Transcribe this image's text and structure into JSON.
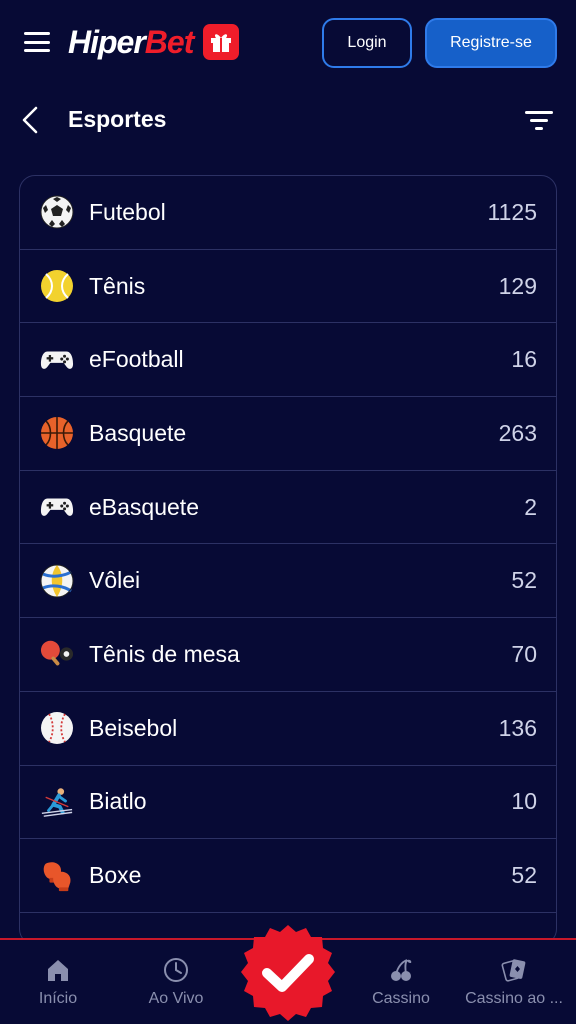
{
  "header": {
    "logo_hiper": "Hiper",
    "logo_bet": "Bet",
    "login_label": "Login",
    "register_label": "Registre-se"
  },
  "section": {
    "title": "Esportes"
  },
  "sports": [
    {
      "name": "Futebol",
      "count": "1125",
      "icon": "soccer-ball-icon"
    },
    {
      "name": "Tênis",
      "count": "129",
      "icon": "tennis-ball-icon"
    },
    {
      "name": "eFootball",
      "count": "16",
      "icon": "gamepad-icon"
    },
    {
      "name": "Basquete",
      "count": "263",
      "icon": "basketball-icon"
    },
    {
      "name": "eBasquete",
      "count": "2",
      "icon": "gamepad-icon"
    },
    {
      "name": "Vôlei",
      "count": "52",
      "icon": "volleyball-icon"
    },
    {
      "name": "Tênis de mesa",
      "count": "70",
      "icon": "ping-pong-icon"
    },
    {
      "name": "Beisebol",
      "count": "136",
      "icon": "baseball-icon"
    },
    {
      "name": "Biatlo",
      "count": "10",
      "icon": "skier-icon"
    },
    {
      "name": "Boxe",
      "count": "52",
      "icon": "boxing-glove-icon"
    }
  ],
  "nav": {
    "home_label": "Início",
    "live_label": "Ao Vivo",
    "casino_label": "Cassino",
    "live_casino_label": "Cassino ao ..."
  },
  "colors": {
    "background": "#070a35",
    "accent_blue": "#1660c9",
    "brand_red": "#ef1d2a",
    "divider": "#2c3164"
  }
}
